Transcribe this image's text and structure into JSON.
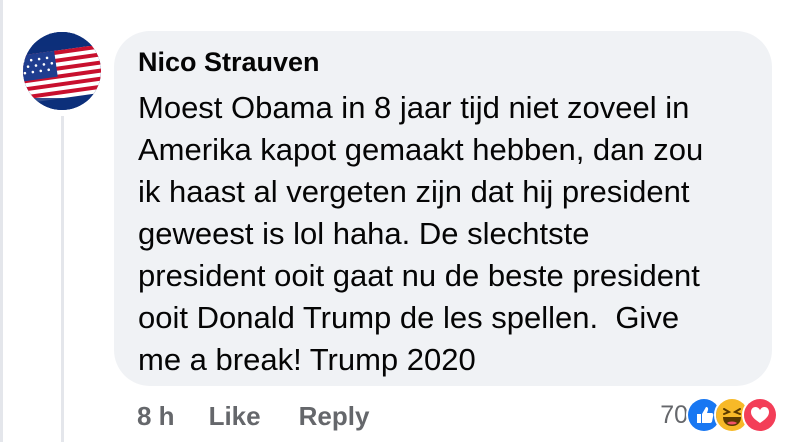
{
  "comment": {
    "author": "Nico Strauven",
    "text_lines": [
      "Moest Obama in 8 jaar tijd niet zoveel in",
      "Amerika kapot gemaakt hebben, dan zou",
      "ik haast al vergeten zijn dat hij president",
      "geweest is lol haha. De slechtste",
      "president ooit gaat nu de beste president",
      "ooit Donald Trump de les spellen.  Give",
      "me a break! Trump 2020"
    ],
    "timestamp": "8 h",
    "like_label": "Like",
    "reply_label": "Reply",
    "reaction_count": "70",
    "reactions": [
      "like-icon",
      "haha-icon",
      "love-icon"
    ]
  },
  "colors": {
    "bubble": "#f0f2f5",
    "text": "#050505",
    "meta": "#65676b",
    "like_blue": "#1877f2",
    "haha_yellow": "#f7b928",
    "love_red": "#f33e58"
  }
}
